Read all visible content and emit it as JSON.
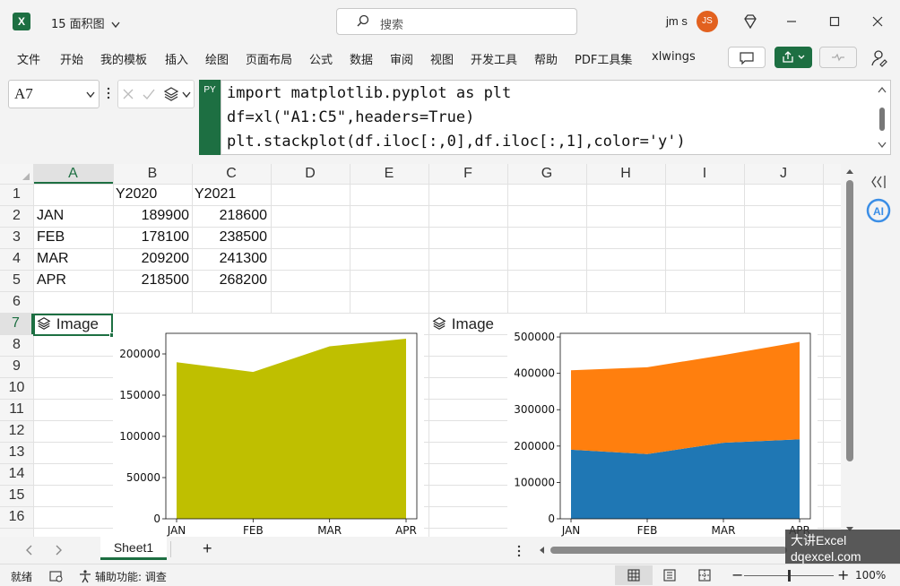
{
  "titlebar": {
    "app_icon": "excel-logo-icon",
    "logo_letter": "X",
    "doc_title": "15 面积图",
    "search_placeholder": "搜索",
    "user_name": "jm s",
    "user_initials": "JS"
  },
  "ribbon": {
    "tabs": [
      "文件",
      "开始",
      "我的模板",
      "插入",
      "绘图",
      "页面布局",
      "公式",
      "数据",
      "审阅",
      "视图",
      "开发工具",
      "帮助",
      "PDF工具集",
      "xlwings"
    ]
  },
  "formula_bar": {
    "name_box": "A7",
    "python_badge": "PY",
    "code_lines": [
      "import matplotlib.pyplot as plt",
      "df=xl(\"A1:C5\",headers=True)",
      "plt.stackplot(df.iloc[:,0],df.iloc[:,1],color='y')"
    ]
  },
  "grid": {
    "columns": [
      "A",
      "B",
      "C",
      "D",
      "E",
      "F",
      "G",
      "H",
      "I",
      "J"
    ],
    "rows": [
      "1",
      "2",
      "3",
      "4",
      "5",
      "6",
      "7",
      "8",
      "9",
      "10",
      "11",
      "12",
      "13",
      "14",
      "15",
      "16"
    ],
    "header_row": [
      "",
      "Y2020",
      "Y2021"
    ],
    "data": [
      [
        "JAN",
        "189900",
        "218600"
      ],
      [
        "FEB",
        "178100",
        "238500"
      ],
      [
        "MAR",
        "209200",
        "241300"
      ],
      [
        "APR",
        "218500",
        "268200"
      ]
    ],
    "image_label": "Image"
  },
  "chart_data": [
    {
      "type": "area",
      "categories": [
        "JAN",
        "FEB",
        "MAR",
        "APR"
      ],
      "series": [
        {
          "values": [
            189900,
            178100,
            209200,
            218500
          ],
          "color": "#bfbf00"
        }
      ],
      "ylim": [
        0,
        225000
      ],
      "yticks": [
        0,
        50000,
        100000,
        150000,
        200000
      ],
      "ytick_labels": [
        "0",
        "50000",
        "100000",
        "150000",
        "200000"
      ]
    },
    {
      "type": "area",
      "stacked": true,
      "categories": [
        "JAN",
        "FEB",
        "MAR",
        "APR"
      ],
      "series": [
        {
          "values": [
            189900,
            178100,
            209200,
            218500
          ],
          "color": "#1f77b4"
        },
        {
          "values": [
            218600,
            238500,
            241300,
            268200
          ],
          "color": "#ff7f0e"
        }
      ],
      "ylim": [
        0,
        510000
      ],
      "yticks": [
        0,
        100000,
        200000,
        300000,
        400000,
        500000
      ],
      "ytick_labels": [
        "0",
        "100000",
        "200000",
        "300000",
        "400000",
        "500000"
      ]
    }
  ],
  "sheet_tabs": {
    "active": "Sheet1",
    "add": "+"
  },
  "watermark": {
    "line1": "大讲Excel",
    "line2": "dqexcel.com"
  },
  "statusbar": {
    "ready": "就绪",
    "accessibility": "辅助功能: 调查",
    "zoom": "100%"
  },
  "colors": {
    "accent": "#1d6f42",
    "avatar": "#e2611f"
  }
}
